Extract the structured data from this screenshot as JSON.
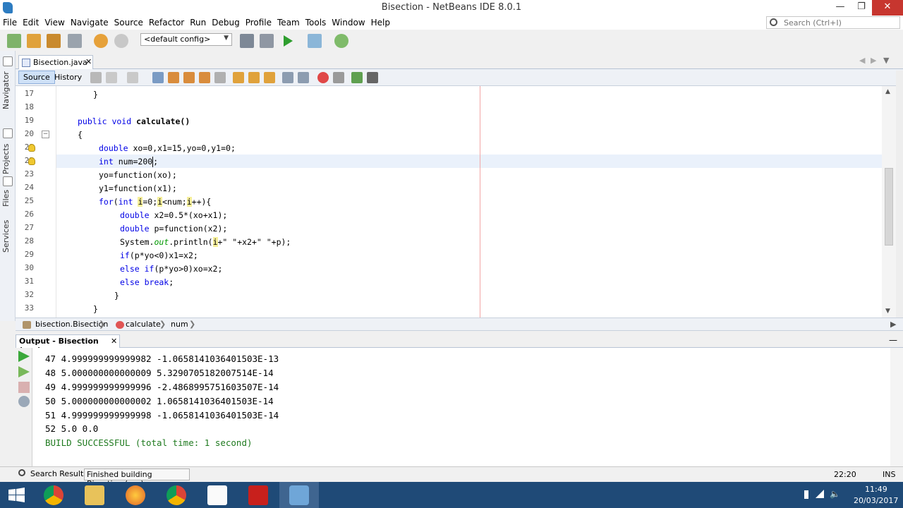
{
  "window": {
    "title": "Bisection - NetBeans IDE 8.0.1"
  },
  "menu": [
    "File",
    "Edit",
    "View",
    "Navigate",
    "Source",
    "Refactor",
    "Run",
    "Debug",
    "Profile",
    "Team",
    "Tools",
    "Window",
    "Help"
  ],
  "search": {
    "placeholder": "Search (Ctrl+I)"
  },
  "toolbar": {
    "config": "<default config>"
  },
  "side_tabs": [
    "Navigator",
    "Projects",
    "Files",
    "Services"
  ],
  "editor": {
    "file_tab": "Bisection.java",
    "source_label": "Source",
    "history_label": "History",
    "line_numbers": [
      "17",
      "18",
      "19",
      "20",
      "21",
      "22",
      "23",
      "24",
      "25",
      "26",
      "27",
      "28",
      "29",
      "30",
      "31",
      "32",
      "33"
    ],
    "lines": {
      "l17": "}",
      "l19_kw": "public void",
      "l19_rest": " calculate()",
      "l20": "{",
      "l21_kw": "double",
      "l21_rest": " xo=0,x1=15,yo=0,y1=0;",
      "l22_kw": "int",
      "l22_rest": " num=200",
      "l22_semi": ";",
      "l23": "yo=function(xo);",
      "l24": "y1=function(x1);",
      "l25_kw1": "for",
      "l25_p1": "(",
      "l25_kw2": "int",
      "l25_p2": " ",
      "l25_i1": "i",
      "l25_p3": "=0;",
      "l25_i2": "i",
      "l25_p4": "<num;",
      "l25_i3": "i",
      "l25_p5": "++){",
      "l26_kw": "double",
      "l26_rest": " x2=0.5*(xo+x1);",
      "l27_kw": "double",
      "l27_rest": " p=function(x2);",
      "l28_a": "System.",
      "l28_out": "out",
      "l28_b": ".println(",
      "l28_i": "i",
      "l28_c": "+\" \"+x2+\" \"+p);",
      "l29_kw": "if",
      "l29_rest": "(p*yo<0)x1=x2;",
      "l30_kw": "else if",
      "l30_rest": "(p*yo>0)xo=x2;",
      "l31_kw": "else break",
      "l31_rest": ";",
      "l32": "}",
      "l33": "}"
    }
  },
  "breadcrumb": [
    "bisection.Bisection",
    "calculate",
    "num"
  ],
  "output": {
    "tab": "Output - Bisection (run)",
    "lines": [
      "47 4.999999999999982 -1.0658141036401503E-13",
      "48 5.000000000000009 5.3290705182007514E-14",
      "49 4.999999999999996 -2.4868995751603507E-14",
      "50 5.000000000000002 1.0658141036401503E-14",
      "51 4.999999999999998 -1.0658141036401503E-14",
      "52 5.0 0.0"
    ],
    "build": "BUILD SUCCESSFUL (total time: 1 second)"
  },
  "status": {
    "search_results": "Search Results",
    "message": "Finished building Bisection (run).",
    "position": "22:20",
    "mode": "INS"
  },
  "tray": {
    "time": "11:49",
    "date": "20/03/2017"
  }
}
